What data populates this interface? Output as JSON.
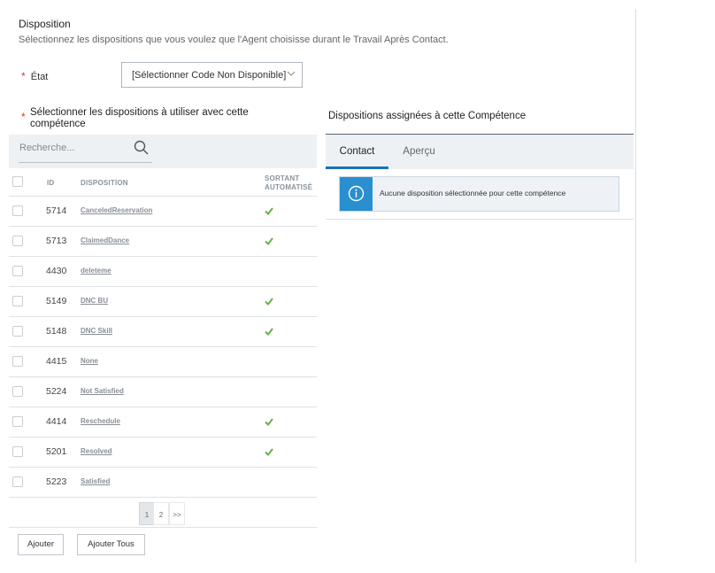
{
  "header": {
    "title": "Disposition",
    "description": "Sélectionnez les dispositions que vous voulez que l'Agent choisisse durant le Travail Après Contact."
  },
  "etat": {
    "required_mark": "*",
    "label": "État",
    "selected_value": "[Sélectionner Code Non Disponible]",
    "icon": "chevron-down-icon"
  },
  "left_panel": {
    "required_mark": "*",
    "title": "Sélectionner les dispositions à utiliser avec cette compétence",
    "search": {
      "placeholder": "Recherche...",
      "icon": "search-icon"
    },
    "columns": {
      "id": "ID",
      "disposition": "DISPOSITION",
      "sortant_line1": "SORTANT",
      "sortant_line2": "AUTOMATISÉ"
    },
    "rows": [
      {
        "id": "5714",
        "disposition": "CanceledReservation",
        "sortant": true
      },
      {
        "id": "5713",
        "disposition": "ClaimedDance",
        "sortant": true
      },
      {
        "id": "4430",
        "disposition": "deleteme",
        "sortant": false
      },
      {
        "id": "5149",
        "disposition": "DNC BU",
        "sortant": true
      },
      {
        "id": "5148",
        "disposition": "DNC Skill",
        "sortant": true
      },
      {
        "id": "4415",
        "disposition": "None",
        "sortant": false
      },
      {
        "id": "5224",
        "disposition": "Not Satisfied",
        "sortant": false
      },
      {
        "id": "4414",
        "disposition": "Reschedule",
        "sortant": true
      },
      {
        "id": "5201",
        "disposition": "Resolved",
        "sortant": true
      },
      {
        "id": "5223",
        "disposition": "Satisfied",
        "sortant": false
      }
    ],
    "pagination": {
      "pages": [
        "1",
        "2"
      ],
      "current": "1",
      "next": ">>"
    },
    "buttons": {
      "add": "Ajouter",
      "add_all": "Ajouter Tous"
    }
  },
  "right_panel": {
    "title": "Dispositions assignées à cette Compétence",
    "tabs": [
      {
        "label": "Contact",
        "active": true
      },
      {
        "label": "Aperçu",
        "active": false
      }
    ],
    "info_message": "Aucune disposition sélectionnée pour cette compétence",
    "info_icon": "info-icon"
  },
  "colors": {
    "accent": "#1a72b8",
    "info_blue": "#2a8fd0",
    "check_green": "#6ab04c",
    "required_red": "#d9303e",
    "panel_bg": "#edf1f4"
  }
}
